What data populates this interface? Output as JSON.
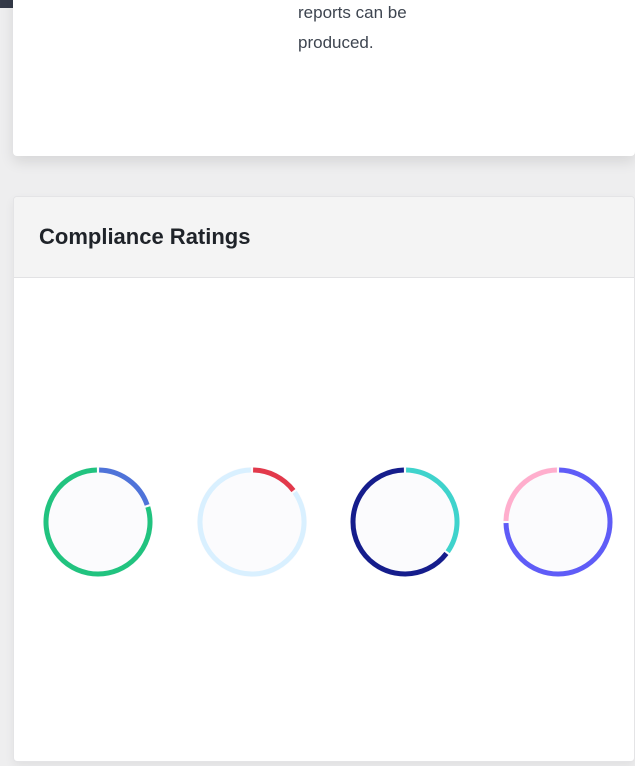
{
  "intro_card": {
    "text_line_1": "reports can be",
    "text_line_2": "produced."
  },
  "compliance": {
    "title": "Compliance Ratings",
    "donuts": [
      {
        "value_fraction": 0.2,
        "value_color": "#4f73d9",
        "remainder_color": "#21c37f"
      },
      {
        "value_fraction": 0.15,
        "value_color": "#e2394b",
        "remainder_color": "#d9f0ff"
      },
      {
        "value_fraction": 0.35,
        "value_color": "#3fd3cc",
        "remainder_color": "#151d8c"
      },
      {
        "value_fraction": 0.75,
        "value_color": "#5f5cf7",
        "remainder_color": "#ffaecd"
      }
    ]
  }
}
